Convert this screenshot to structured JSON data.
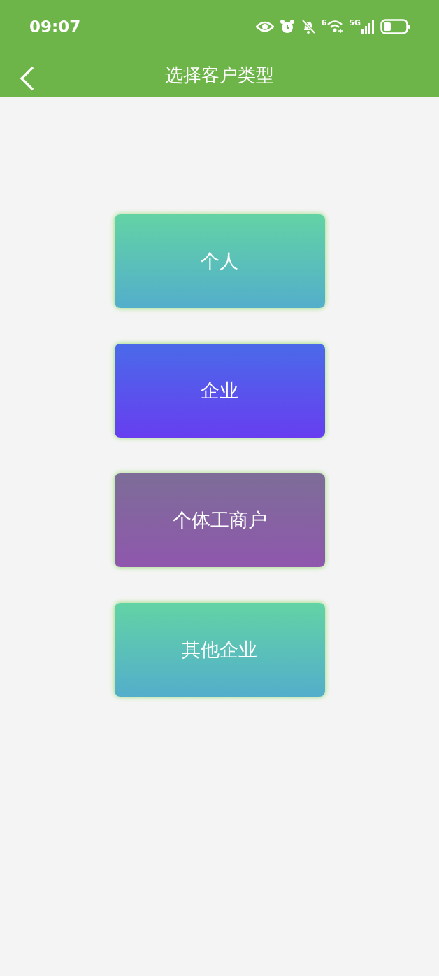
{
  "status_bar": {
    "time": "09:07",
    "wifi_badge": "6",
    "network": "5G"
  },
  "header": {
    "title": "选择客户类型"
  },
  "options": [
    {
      "label": "个人",
      "kind": "green"
    },
    {
      "label": "企业",
      "kind": "blue"
    },
    {
      "label": "个体工商户",
      "kind": "violet"
    },
    {
      "label": "其他企业",
      "kind": "green"
    }
  ]
}
